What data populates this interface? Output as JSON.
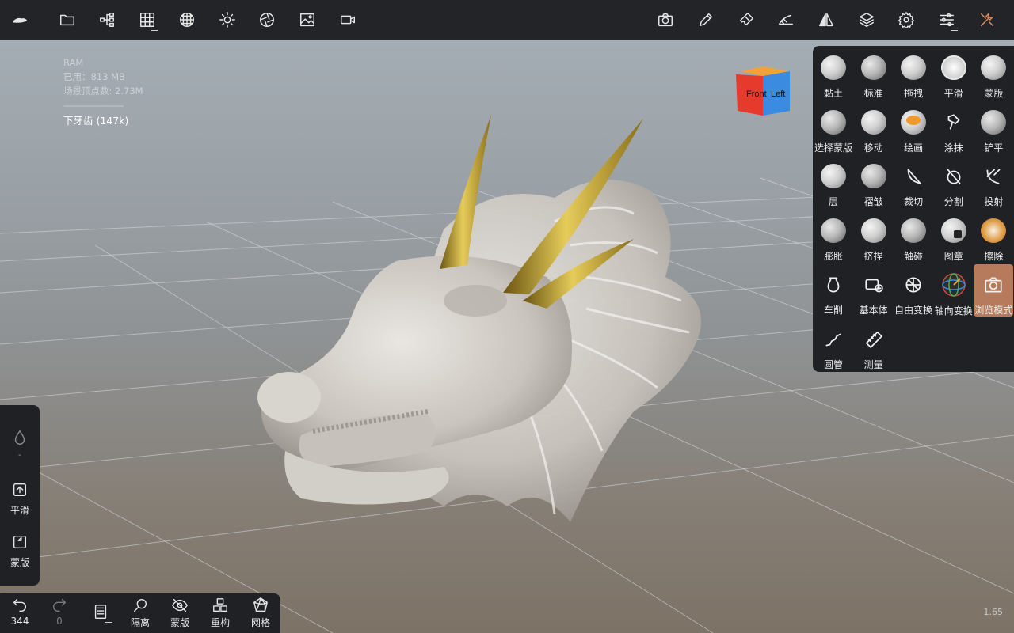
{
  "stats": {
    "title": "RAM",
    "used": "已用：813 MB",
    "vertices": "场景顶点数: 2.73M",
    "separator": "------------------------",
    "mesh": "下牙齿 (147k)"
  },
  "cube": {
    "front": "Front",
    "left": "Left",
    "front_color": "#e53a2c",
    "left_color": "#3b8be0",
    "top_color": "#f0a338"
  },
  "top_toolbar": {
    "left_icons": [
      "app-logo-icon",
      "folder-icon",
      "scene-tree-icon",
      "grid-icon",
      "sphere-icon",
      "sun-icon",
      "aperture-icon",
      "image-icon",
      "video-icon"
    ],
    "right_icons": [
      "camera-icon",
      "pencil-icon",
      "brush-icon",
      "stroke-icon",
      "symmetry-icon",
      "layers-icon",
      "settings-icon",
      "sliders-icon",
      "tools-icon"
    ]
  },
  "tools": [
    {
      "label": "黏土",
      "icon": "clay-icon"
    },
    {
      "label": "标准",
      "icon": "standard-icon"
    },
    {
      "label": "拖拽",
      "icon": "drag-icon"
    },
    {
      "label": "平滑",
      "icon": "smooth-icon"
    },
    {
      "label": "蒙版",
      "icon": "mask-icon"
    },
    {
      "label": "选择蒙版",
      "icon": "select-mask-icon"
    },
    {
      "label": "移动",
      "icon": "move-icon"
    },
    {
      "label": "绘画",
      "icon": "paint-icon"
    },
    {
      "label": "涂抹",
      "icon": "smudge-icon"
    },
    {
      "label": "铲平",
      "icon": "flatten-icon"
    },
    {
      "label": "层",
      "icon": "layer-icon"
    },
    {
      "label": "褶皱",
      "icon": "crease-icon"
    },
    {
      "label": "裁切",
      "icon": "trim-icon"
    },
    {
      "label": "分割",
      "icon": "split-icon"
    },
    {
      "label": "投射",
      "icon": "project-icon"
    },
    {
      "label": "膨胀",
      "icon": "inflate-icon"
    },
    {
      "label": "挤捏",
      "icon": "pinch-icon"
    },
    {
      "label": "触碰",
      "icon": "tube-touch-icon"
    },
    {
      "label": "图章",
      "icon": "stamp-icon"
    },
    {
      "label": "擦除",
      "icon": "erase-icon"
    },
    {
      "label": "车削",
      "icon": "lathe-icon"
    },
    {
      "label": "基本体",
      "icon": "primitive-icon"
    },
    {
      "label": "自由变换",
      "icon": "free-transform-icon"
    },
    {
      "label": "轴向变换",
      "icon": "gizmo-icon"
    },
    {
      "label": "浏览模式",
      "icon": "view-mode-icon"
    },
    {
      "label": "圆管",
      "icon": "tube-icon"
    },
    {
      "label": "测量",
      "icon": "measure-icon"
    }
  ],
  "left_panel": {
    "dot": "-",
    "smooth_label": "平滑",
    "mask_label": "蒙版"
  },
  "bottom_bar": {
    "undo_count": "344",
    "redo_count": "0",
    "isolate": "隔离",
    "mask": "蒙版",
    "remesh": "重构",
    "mesh": "网格"
  },
  "zoom": "1.65",
  "colors": {
    "toolbar_bg": "#222428",
    "panel_bg": "#1f2125",
    "active_tool": "#b57b5c",
    "horn_gold": "#c8a633"
  }
}
